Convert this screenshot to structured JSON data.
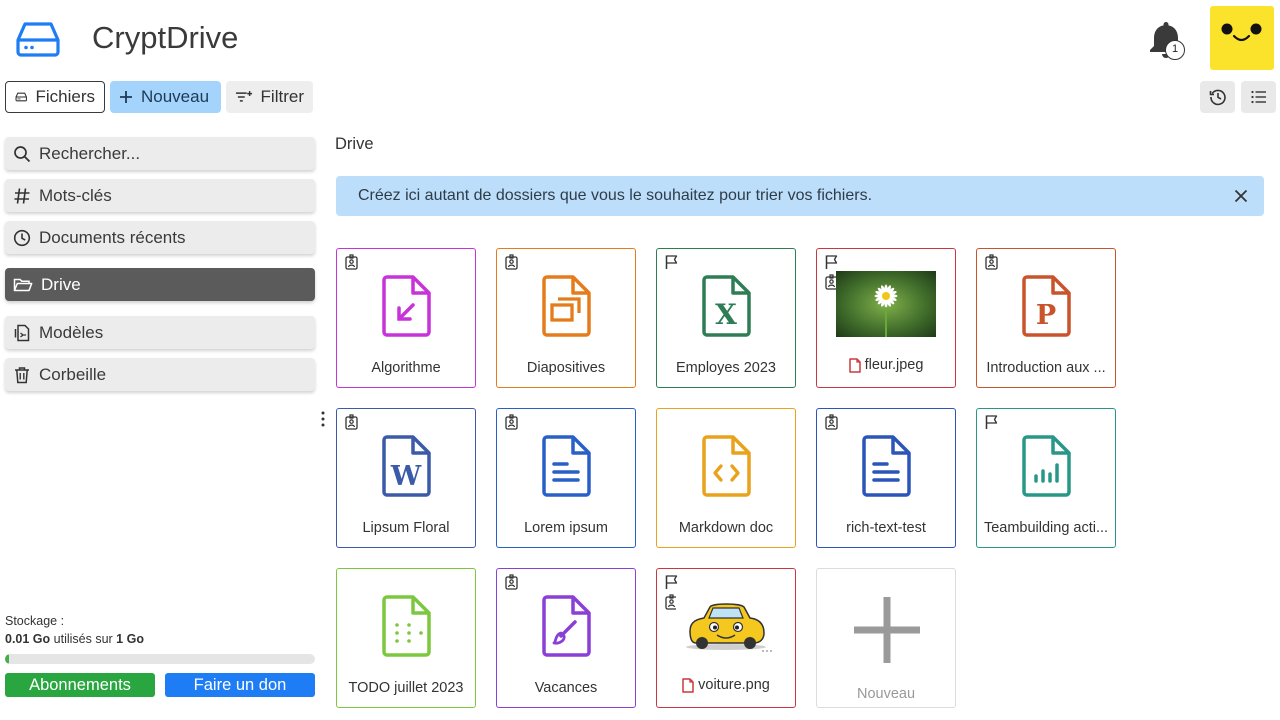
{
  "header": {
    "app_title": "CryptDrive",
    "notification_count": "1",
    "avatar_color": "#fbe32c"
  },
  "toolbar": {
    "files_label": "Fichiers",
    "new_label": "Nouveau",
    "filter_label": "Filtrer",
    "history_icon": "history-icon",
    "list_view_icon": "list-view-icon"
  },
  "sidebar": {
    "items": [
      {
        "label": "Rechercher...",
        "icon": "search-icon"
      },
      {
        "label": "Mots-clés",
        "icon": "hashtag-icon"
      },
      {
        "label": "Documents récents",
        "icon": "clock-icon"
      },
      {
        "label": "Drive",
        "icon": "folder-open-icon",
        "active": true
      },
      {
        "label": "Modèles",
        "icon": "template-icon"
      },
      {
        "label": "Corbeille",
        "icon": "trash-icon"
      }
    ],
    "storage": {
      "label": "Stockage :",
      "used": "0.01 Go",
      "mid_text": " utilisés sur ",
      "total": "1 Go",
      "used_fraction": 0.01
    },
    "subscribe_label": "Abonnements",
    "donate_label": "Faire un don"
  },
  "main": {
    "breadcrumb": "Drive",
    "banner_text": "Créez ici autant de dossiers que vous le souhaitez pour trier vos fichiers.",
    "tiles": [
      {
        "name": "Algorithme",
        "type": "code-app",
        "color": "#c733d8",
        "marks": [
          "owner-badge-icon"
        ]
      },
      {
        "name": "Diapositives",
        "type": "slides",
        "color": "#e57c1b",
        "marks": [
          "owner-badge-icon"
        ]
      },
      {
        "name": "Employes 2023",
        "type": "sheet",
        "color": "#2e7d55",
        "marks": [
          "flag-icon"
        ]
      },
      {
        "name": "fleur.jpeg",
        "type": "image-flower",
        "color": "#c9383f",
        "marks": [
          "flag-icon",
          "owner-badge-icon"
        ]
      },
      {
        "name": "Introduction aux ...",
        "type": "presentation",
        "color": "#c9542c",
        "marks": [
          "owner-badge-icon"
        ]
      },
      {
        "name": "Lipsum Floral",
        "type": "word",
        "color": "#3b5ba9",
        "marks": [
          "owner-badge-icon"
        ]
      },
      {
        "name": "Lorem ipsum",
        "type": "richtext",
        "color": "#2960c7",
        "marks": [
          "owner-badge-icon"
        ]
      },
      {
        "name": "Markdown doc",
        "type": "code",
        "color": "#e8a21c",
        "marks": []
      },
      {
        "name": "rich-text-test",
        "type": "richtext",
        "color": "#2b55b8",
        "marks": [
          "owner-badge-icon"
        ]
      },
      {
        "name": "Teambuilding acti...",
        "type": "form",
        "color": "#289787",
        "marks": [
          "flag-icon"
        ]
      },
      {
        "name": "TODO juillet 2023",
        "type": "kanban",
        "color": "#7dc73f",
        "marks": []
      },
      {
        "name": "Vacances",
        "type": "whiteboard",
        "color": "#8a3fd6",
        "marks": [
          "owner-badge-icon"
        ]
      },
      {
        "name": "voiture.png",
        "type": "image-car",
        "color": "#c9383f",
        "marks": [
          "flag-icon",
          "owner-badge-icon"
        ]
      }
    ],
    "new_tile_label": "Nouveau"
  }
}
